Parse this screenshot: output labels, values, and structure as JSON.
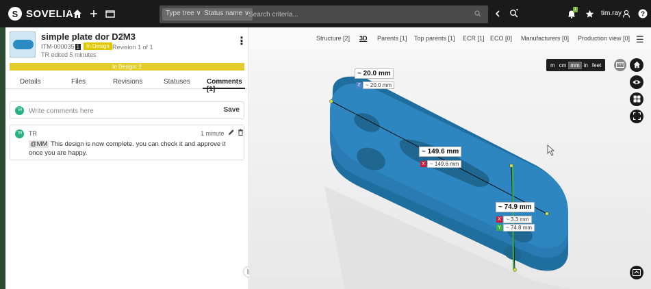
{
  "topbar": {
    "logo_letter": "S",
    "logo_text": "SOVELIA",
    "home_icon": "home-icon",
    "add_icon": "plus-icon",
    "folder_icon": "folder-icon",
    "type_tree_label": "Type tree ∨",
    "status_name_label": "Status name ∨",
    "search_placeholder": "Search criteria...",
    "notification_count": "1",
    "user_name": "tim.ray"
  },
  "item": {
    "title": "simple plate dor D2M3",
    "code": "ITM-000035",
    "revision_num": "1",
    "state": "In Design",
    "revision_text": "Revision 1 of 1",
    "edited": "TR edited 5 minutes",
    "state_bar": "In Design: 2"
  },
  "tabs": [
    "Details",
    "Files",
    "Revisions",
    "Statuses",
    "Comments [1]"
  ],
  "comments": {
    "input_placeholder": "Write comments here",
    "save_label": "Save",
    "avatar_initials": "TR",
    "entries": [
      {
        "author": "TR",
        "time": "1 minute",
        "mention": "@MM",
        "text": "This design is now complete. you can check it and approve it once you are happy."
      }
    ]
  },
  "viewer": {
    "tabs": [
      "Structure [2]",
      "3D",
      "Parents [1]",
      "Top parents [1]",
      "ECR [1]",
      "ECO [0]",
      "Manufacturers [0]",
      "Production view [0]"
    ],
    "active_tab": "3D",
    "units": [
      "m",
      "cm",
      "mm",
      "in",
      "feet"
    ],
    "active_unit": "mm",
    "model_color": "#2e86c1",
    "dimensions": [
      {
        "label": "~ 20.0 mm",
        "components": [
          {
            "axis": "Z",
            "value": "~ 20.0 mm"
          }
        ]
      },
      {
        "label": "~ 149.6 mm",
        "components": [
          {
            "axis": "X",
            "value": "~ 149.6 mm"
          }
        ]
      },
      {
        "label": "~ 74.9 mm",
        "components": [
          {
            "axis": "X",
            "value": "~ 3.3 mm"
          },
          {
            "axis": "Y",
            "value": "~ 74.8 mm"
          }
        ]
      }
    ]
  }
}
